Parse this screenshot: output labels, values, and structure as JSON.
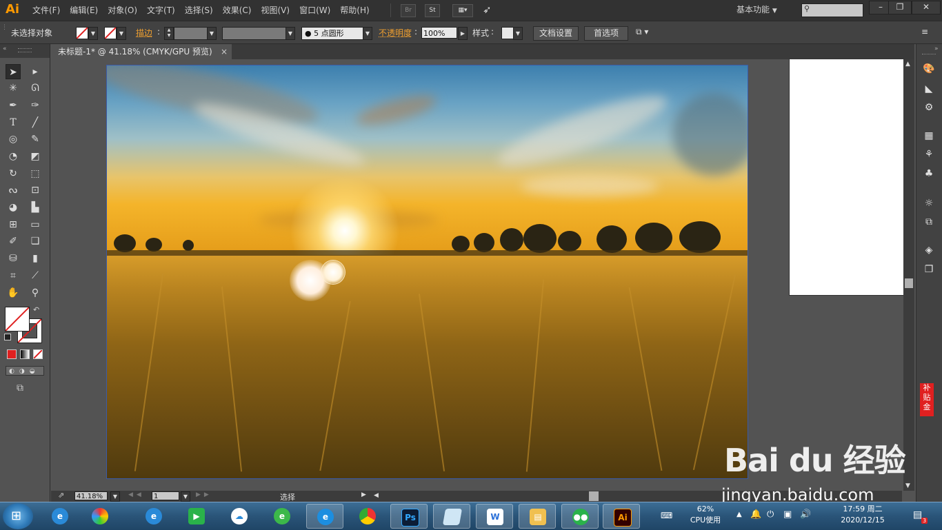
{
  "app": {
    "logo": "Ai",
    "accent": "#ff9a00"
  },
  "menu": [
    "文件(F)",
    "编辑(E)",
    "对象(O)",
    "文字(T)",
    "选择(S)",
    "效果(C)",
    "视图(V)",
    "窗口(W)",
    "帮助(H)"
  ],
  "menubar_buttons": {
    "bridge": "Br",
    "stock": "St"
  },
  "workspace": {
    "label": "基本功能"
  },
  "control": {
    "selection_status": "未选择对象",
    "stroke_label": "描边",
    "brush_label": "5 点圆形",
    "opacity_label": "不透明度",
    "opacity_value": "100%",
    "style_label": "样式",
    "doc_setup_button": "文档设置",
    "preferences_button": "首选项"
  },
  "document": {
    "tab_title": "未标题-1* @ 41.18% (CMYK/GPU 预览)",
    "close": "×"
  },
  "status": {
    "zoom": "41.18%",
    "artboard_number": "1",
    "tool_name": "选择"
  },
  "dock": {
    "subsidy_badge": "补贴金"
  },
  "watermark": {
    "logo_text": "Bai du 经验",
    "url": "jingyan.baidu.com"
  },
  "taskbar": {
    "cpu_percent": "62%",
    "cpu_label": "CPU使用",
    "time": "17:59 周二",
    "date": "2020/12/15",
    "notification_count": "3",
    "ps_label": "Ps",
    "ai_label": "Ai"
  },
  "icons": [
    "selection-tool-icon",
    "direct-selection-tool-icon",
    "magic-wand-icon",
    "lasso-icon",
    "pen-tool-icon",
    "curvature-icon",
    "type-tool-icon",
    "line-tool-icon",
    "rectangle-tool-icon",
    "paintbrush-icon",
    "shaper-tool-icon",
    "eraser-icon",
    "rotate-tool-icon",
    "scale-tool-icon",
    "width-tool-icon",
    "free-transform-icon",
    "shape-builder-icon",
    "perspective-grid-icon",
    "mesh-tool-icon",
    "gradient-tool-icon",
    "eyedropper-icon",
    "blend-tool-icon",
    "symbol-sprayer-icon",
    "column-graph-icon",
    "artboard-tool-icon",
    "slice-tool-icon",
    "hand-tool-icon",
    "zoom-tool-icon"
  ]
}
